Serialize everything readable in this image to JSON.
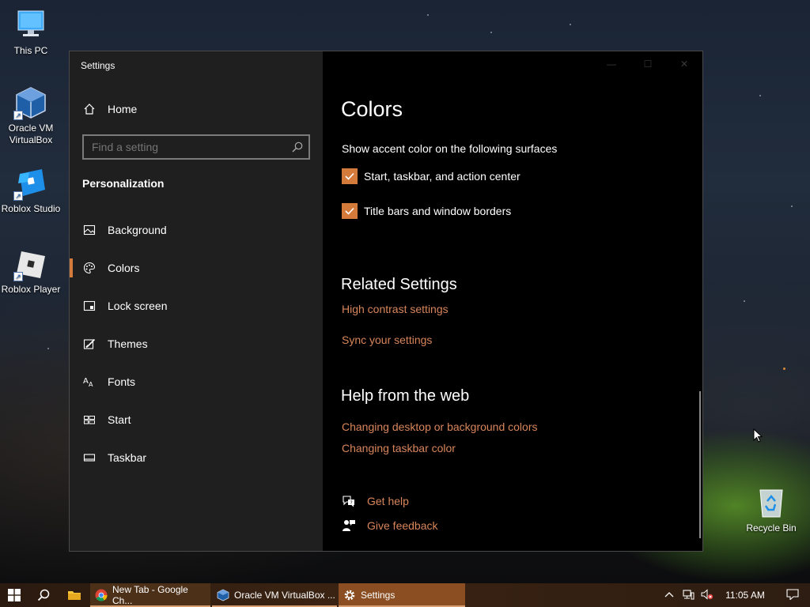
{
  "desktop": {
    "icons": [
      {
        "label": "This PC"
      },
      {
        "label": "Oracle VM\nVirtualBox"
      },
      {
        "label": "Roblox Studio"
      },
      {
        "label": "Roblox Player"
      },
      {
        "label": "Recycle Bin"
      }
    ]
  },
  "window": {
    "title": "Settings",
    "controls": {
      "minimize": "—",
      "maximize": "☐",
      "close": "✕"
    }
  },
  "sidebar": {
    "home_label": "Home",
    "search_placeholder": "Find a setting",
    "section_title": "Personalization",
    "items": [
      {
        "label": "Background",
        "icon": "picture-icon"
      },
      {
        "label": "Colors",
        "icon": "palette-icon",
        "active": true
      },
      {
        "label": "Lock screen",
        "icon": "lock-screen-icon"
      },
      {
        "label": "Themes",
        "icon": "themes-brush-icon"
      },
      {
        "label": "Fonts",
        "icon": "fonts-icon"
      },
      {
        "label": "Start",
        "icon": "start-tiles-icon"
      },
      {
        "label": "Taskbar",
        "icon": "taskbar-icon"
      }
    ]
  },
  "content": {
    "title": "Colors",
    "accent_surfaces_label": "Show accent color on the following surfaces",
    "checkboxes": [
      {
        "label": "Start, taskbar, and action center",
        "checked": true
      },
      {
        "label": "Title bars and window borders",
        "checked": true
      }
    ],
    "related_heading": "Related Settings",
    "related_links": [
      "High contrast settings",
      "Sync your settings"
    ],
    "help_heading": "Help from the web",
    "help_links": [
      "Changing desktop or background colors",
      "Changing taskbar color"
    ],
    "get_help": "Get help",
    "give_feedback": "Give feedback"
  },
  "taskbar": {
    "tasks": [
      {
        "label": "New Tab - Google Ch...",
        "icon": "chrome-icon"
      },
      {
        "label": "Oracle VM VirtualBox ...",
        "icon": "virtualbox-icon"
      },
      {
        "label": "Settings",
        "icon": "gear-icon"
      }
    ],
    "clock": "11:05 AM"
  },
  "colors": {
    "accent": "#d47a3b",
    "link": "#d8855a",
    "sidebar_bg": "#1f1f1f",
    "content_bg": "#000000"
  }
}
